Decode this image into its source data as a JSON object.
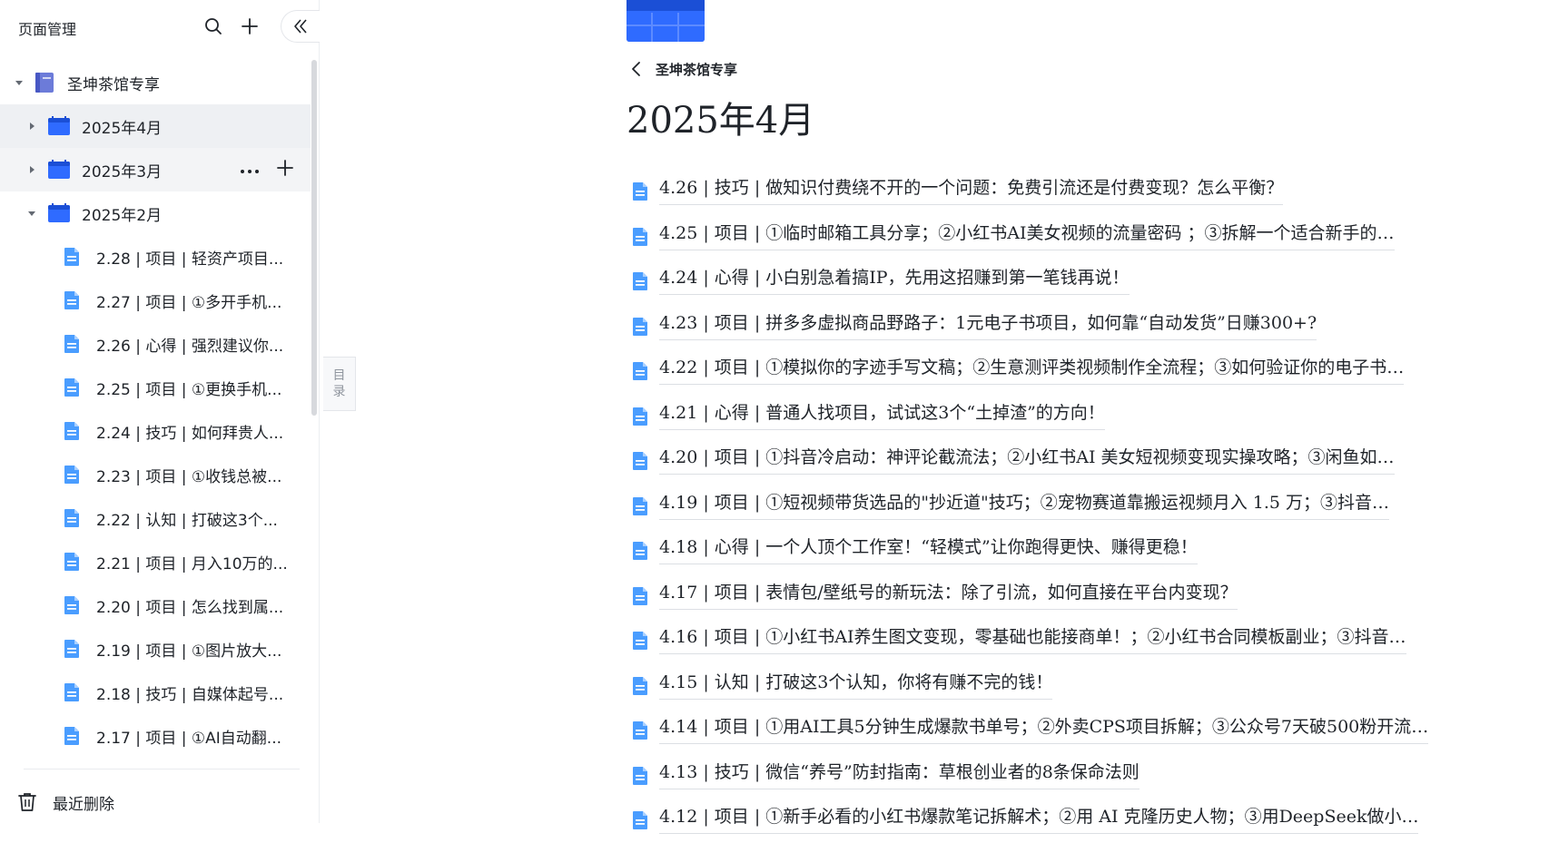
{
  "sidebar": {
    "title": "页面管理",
    "search_icon": "search-icon",
    "add_icon": "plus-icon",
    "collapse_icon": "double-chevron-left-icon",
    "root": {
      "label": "圣坤茶馆专享",
      "icon": "book-icon"
    },
    "folders": [
      {
        "label": "2025年4月",
        "expanded": false,
        "selected": true
      },
      {
        "label": "2025年3月",
        "expanded": false,
        "hover": true
      },
      {
        "label": "2025年2月",
        "expanded": true
      }
    ],
    "children": [
      "2.28 | 项目 | 轻资产项目...",
      "2.27 | 项目 | ①多开手机...",
      "2.26 | 心得 | 强烈建议你...",
      "2.25 | 项目 | ①更换手机...",
      "2.24 | 技巧 | 如何拜贵人...",
      "2.23 | 项目 | ①收钱总被...",
      "2.22 | 认知 | 打破这3个...",
      "2.21 | 项目 | 月入10万的...",
      "2.20 | 项目 | 怎么找到属...",
      "2.19 | 项目 | ①图片放大...",
      "2.18 | 技巧 | 自媒体起号...",
      "2.17 | 项目 | ①AI自动翻..."
    ],
    "more_icon": "ellipsis-icon",
    "trash_label": "最近删除"
  },
  "toc_tab": {
    "line1": "目",
    "line2": "录"
  },
  "main": {
    "back_label": "圣坤茶馆专享",
    "title": "2025年4月",
    "docs": [
      "4.26 | 技巧 | 做知识付费绕不开的一个问题：免费引流还是付费变现？怎么平衡？",
      "4.25 | 项目 | ①临时邮箱工具分享；②小红书AI美女视频的流量密码 ；③拆解一个适合新手的…",
      "4.24 | 心得 | 小白别急着搞IP，先用这招赚到第一笔钱再说！",
      "4.23 | 项目 | 拼多多虚拟商品野路子：1元电子书项目，如何靠“自动发货”日赚300+?",
      "4.22 | 项目 | ①模拟你的字迹手写文稿；②生意测评类视频制作全流程；③如何验证你的电子书…",
      "4.21 | 心得 | 普通人找项目，试试这3个“土掉渣”的方向！",
      "4.20 | 项目 | ①抖音冷启动：神评论截流法；②小红书AI 美女短视频变现实操攻略；③闲鱼如…",
      "4.19 | 项目 | ①短视频带货选品的\"抄近道\"技巧；②宠物赛道靠搬运视频月入 1.5 万；③抖音…",
      "4.18 | 心得 | 一个人顶个工作室！“轻模式”让你跑得更快、赚得更稳！",
      "4.17 | 项目 | 表情包/壁纸号的新玩法：除了引流，如何直接在平台内变现？",
      "4.16 | 项目 | ①小红书AI养生图文变现，零基础也能接商单！；②小红书合同模板副业；③抖音…",
      "4.15 | 认知 | 打破这3个认知，你将有赚不完的钱！",
      "4.14 | 项目 | ①用AI工具5分钟生成爆款书单号；②外卖CPS项目拆解；③公众号7天破500粉开流…",
      "4.13 | 技巧 | 微信“养号”防封指南：草根创业者的8条保命法则",
      "4.12 | 项目 | ①新手必看的小红书爆款笔记拆解术；②用 AI 克隆历史人物；③用DeepSeek做小…"
    ],
    "doc_icon": "document-icon"
  },
  "colors": {
    "accent_blue": "#2f6bff",
    "doc_icon_blue": "#4a9dff",
    "selected_bg": "#eef0f3",
    "text": "#1f2329",
    "muted": "#8f959e"
  }
}
